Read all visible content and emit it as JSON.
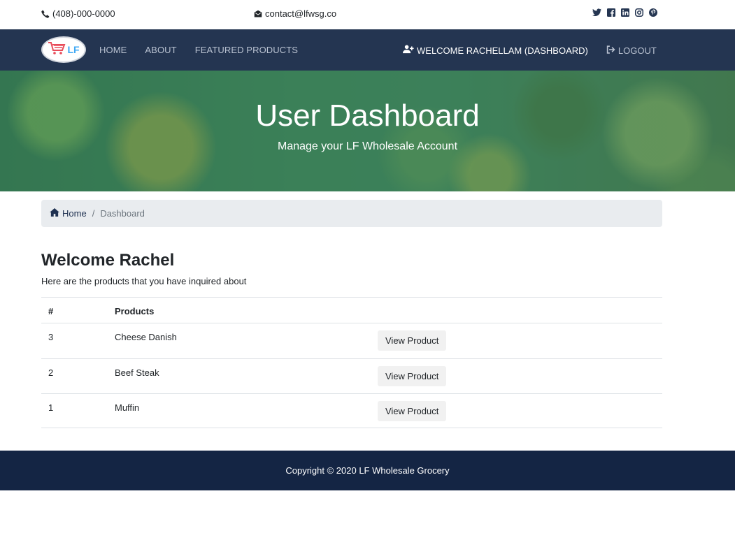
{
  "topbar": {
    "phone": "(408)-000-0000",
    "email": "contact@lfwsg.co",
    "social_icons": [
      "twitter-icon",
      "facebook-icon",
      "linkedin-icon",
      "instagram-icon",
      "pinterest-icon"
    ]
  },
  "navbar": {
    "logo_text": "LF",
    "links": [
      "HOME",
      "ABOUT",
      "FEATURED PRODUCTS"
    ],
    "welcome": "WELCOME RACHELLAM (DASHBOARD)",
    "logout": "LOGOUT"
  },
  "hero": {
    "title": "User Dashboard",
    "subtitle": "Manage your LF Wholesale Account"
  },
  "breadcrumb": {
    "home": "Home",
    "separator": "/",
    "current": "Dashboard"
  },
  "main": {
    "welcome": "Welcome Rachel",
    "intro": "Here are the products that you have inquired about"
  },
  "table": {
    "headers": [
      "#",
      "Products"
    ],
    "rows": [
      {
        "id": "3",
        "product": "Cheese Danish",
        "action": "View Product"
      },
      {
        "id": "2",
        "product": "Beef Steak",
        "action": "View Product"
      },
      {
        "id": "1",
        "product": "Muffin",
        "action": "View Product"
      }
    ]
  },
  "footer": {
    "copyright": "Copyright © 2020 LF Wholesale Grocery"
  },
  "colors": {
    "navbar": "#243551",
    "footer": "#142544",
    "link": "#1e3050",
    "logo_cart": "#e84c5a",
    "logo_text": "#3fa9f5"
  }
}
